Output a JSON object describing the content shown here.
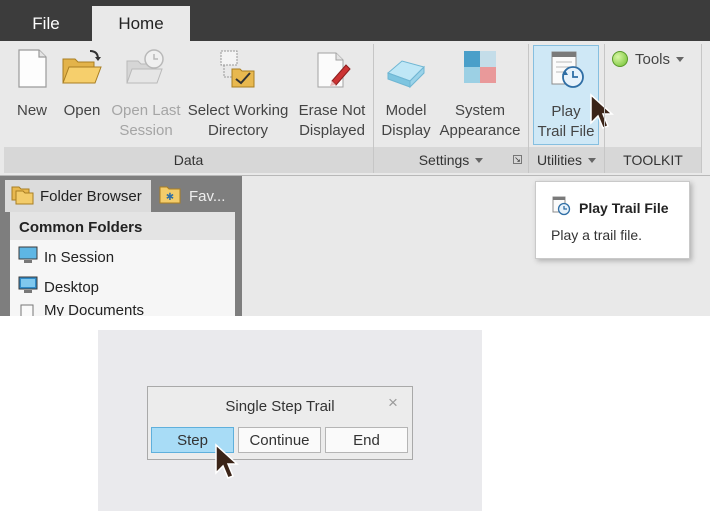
{
  "tabs": {
    "file": "File",
    "home": "Home"
  },
  "ribbon": {
    "data_group": {
      "label": "Data",
      "buttons": [
        {
          "label": "New",
          "icon": "new-file-icon",
          "disabled": false
        },
        {
          "label": "Open",
          "icon": "open-folder-icon",
          "disabled": false
        },
        {
          "label": "Open Last Session",
          "line1": "Open Last",
          "line2": "Session",
          "icon": "open-last-session-icon",
          "disabled": true
        },
        {
          "label": "Select Working Directory",
          "line1": "Select Working",
          "line2": "Directory",
          "icon": "working-directory-icon",
          "disabled": false
        },
        {
          "label": "Erase Not Displayed",
          "line1": "Erase Not",
          "line2": "Displayed",
          "icon": "erase-icon",
          "disabled": false
        }
      ]
    },
    "settings_group": {
      "label": "Settings",
      "buttons": [
        {
          "label": "Model Display",
          "line1": "Model",
          "line2": "Display",
          "icon": "model-display-icon"
        },
        {
          "label": "System Appearance",
          "line1": "System",
          "line2": "Appearance",
          "icon": "system-appearance-icon"
        }
      ]
    },
    "utilities_group": {
      "label": "Utilities",
      "buttons": [
        {
          "label": "Play Trail File",
          "line1": "Play",
          "line2": "Trail File",
          "icon": "play-trail-file-icon",
          "hovered": true
        }
      ]
    },
    "toolkit_group": {
      "label": "TOOLKIT",
      "tools_label": "Tools"
    }
  },
  "tooltip": {
    "title": "Play Trail File",
    "description": "Play a trail file."
  },
  "folder_panel": {
    "tabs": [
      {
        "label": "Folder Browser",
        "icon": "folder-browser-icon",
        "active": true
      },
      {
        "label": "Fav...",
        "icon": "favorites-icon",
        "active": false
      }
    ],
    "heading": "Common Folders",
    "items": [
      {
        "label": "In Session",
        "icon": "monitor-icon"
      },
      {
        "label": "Desktop",
        "icon": "desktop-icon"
      },
      {
        "label": "My Documents",
        "icon": "documents-icon"
      }
    ]
  },
  "dialog": {
    "title": "Single Step Trail",
    "close": "×",
    "buttons": {
      "step": "Step",
      "continue": "Continue",
      "end": "End"
    }
  },
  "colors": {
    "tab_bar": "#3c3c3c",
    "ribbon_bg": "#e9e9e9",
    "hover_highlight": "#cfe8f6",
    "step_button": "#a8dcf6"
  }
}
